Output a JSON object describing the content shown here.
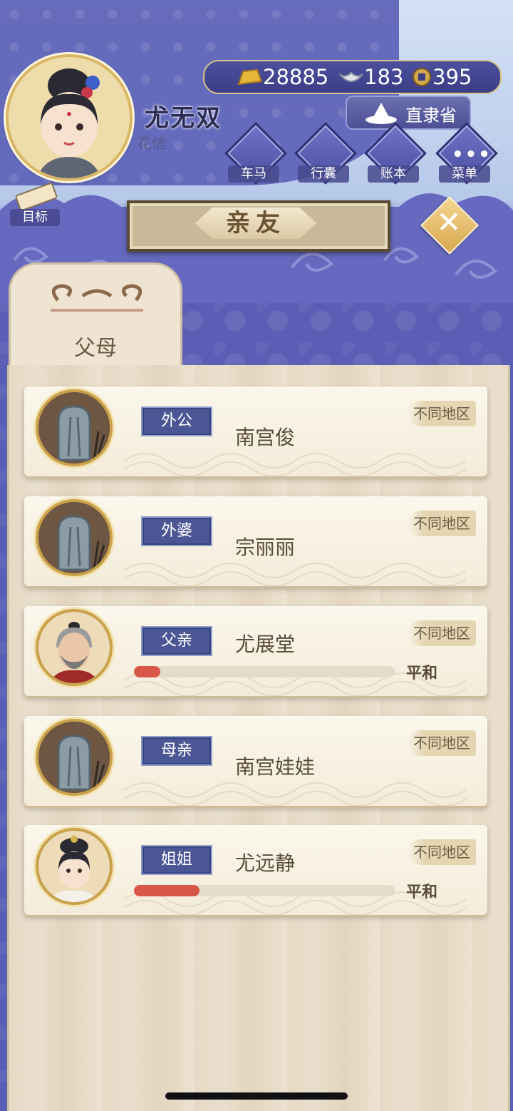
{
  "player": {
    "name": "尤无双",
    "subtitle": "花信",
    "region": "直隶省"
  },
  "resources": {
    "gold": "28885",
    "silver": "183",
    "coin": "395"
  },
  "menu": [
    {
      "label": "车马",
      "icon": "carriage-icon"
    },
    {
      "label": "行囊",
      "icon": "bundle-icon"
    },
    {
      "label": "账本",
      "icon": "ledger-icon"
    },
    {
      "label": "菜单",
      "icon": "more-icon"
    }
  ],
  "goal": {
    "label": "目标"
  },
  "page": {
    "title": "亲友",
    "tab": "父母"
  },
  "relatives": [
    {
      "relation": "外公",
      "name": "南宫俊",
      "region": "不同地区",
      "portrait": "tombstone"
    },
    {
      "relation": "外婆",
      "name": "宗丽丽",
      "region": "不同地区",
      "portrait": "tombstone"
    },
    {
      "relation": "父亲",
      "name": "尤展堂",
      "region": "不同地区",
      "portrait": "old-man",
      "mood": "平和",
      "affinity": 0.1
    },
    {
      "relation": "母亲",
      "name": "南宫娃娃",
      "region": "不同地区",
      "portrait": "tombstone"
    },
    {
      "relation": "姐姐",
      "name": "尤远静",
      "region": "不同地区",
      "portrait": "young-woman",
      "mood": "平和",
      "affinity": 0.25
    }
  ],
  "colors": {
    "primary": "#5c5fb6",
    "relation_tag": "#4b5694",
    "affinity_bar": "#d9574a",
    "gold_accent": "#d9b665"
  }
}
